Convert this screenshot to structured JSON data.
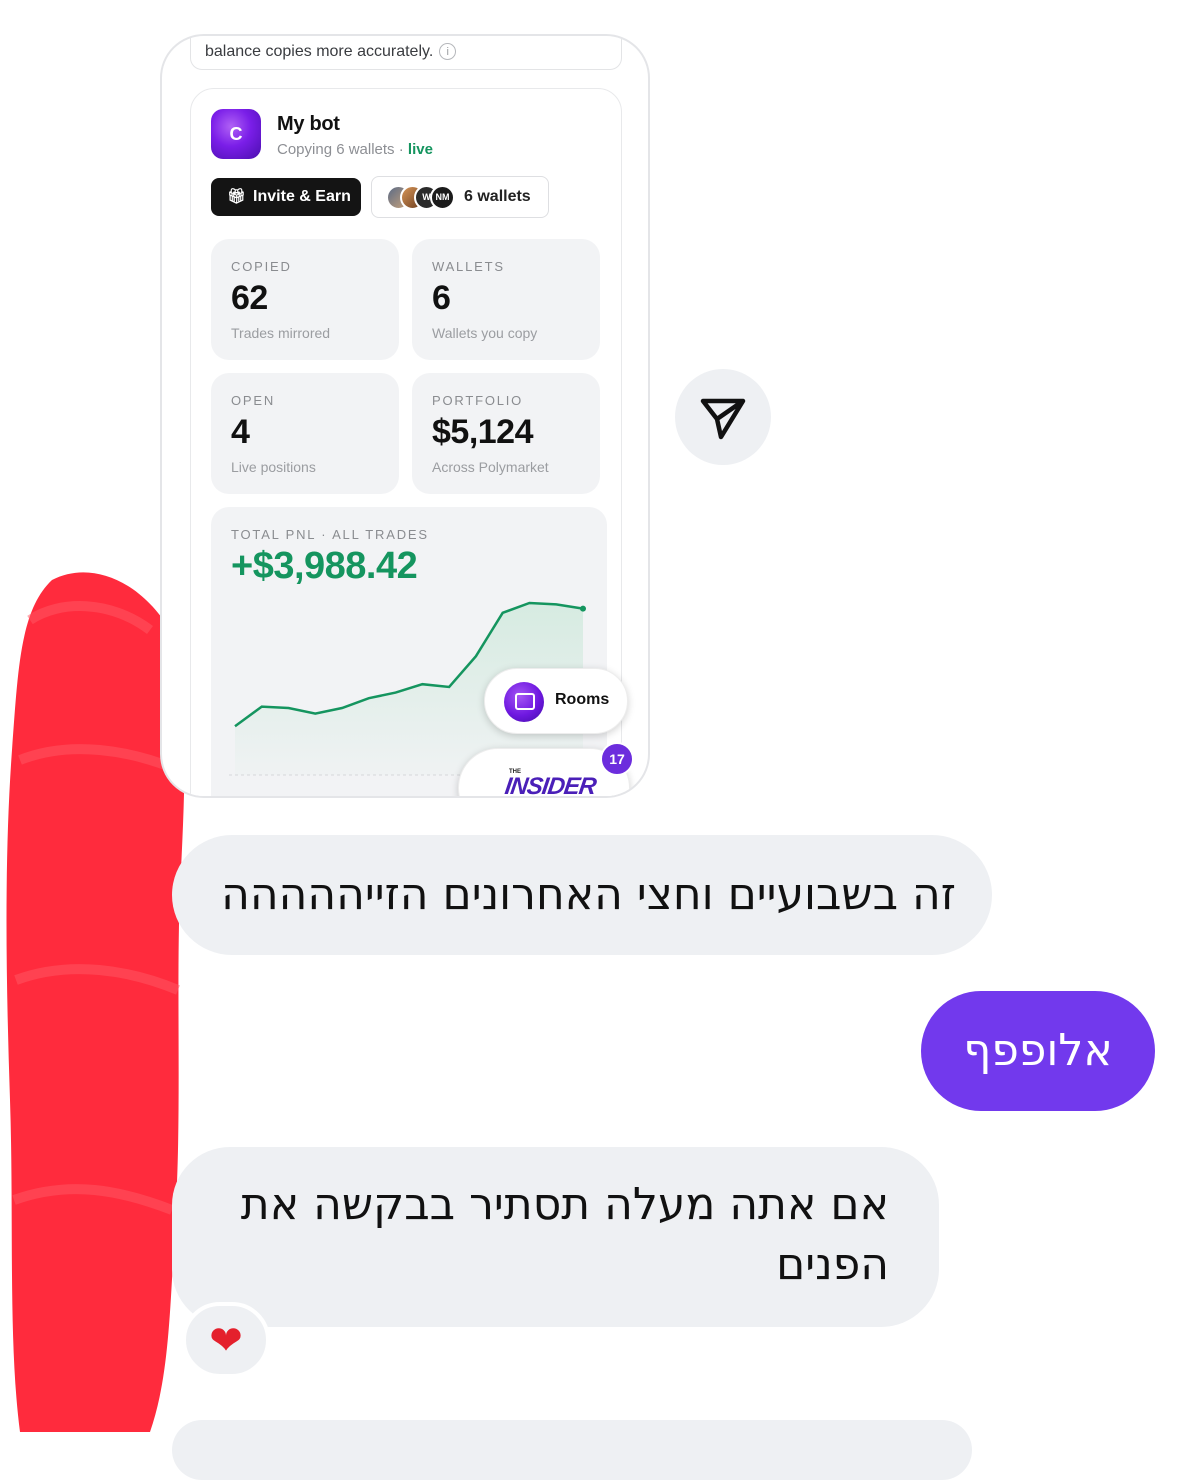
{
  "shot": {
    "info_text": "balance copies more accurately.",
    "info_icon": "info-icon",
    "bot": {
      "avatar_letter": "C",
      "name": "My bot",
      "sub_prefix": "Copying 6 wallets ·",
      "live_label": "live"
    },
    "invite_button": "Invite & Earn",
    "wallets_button": "6 wallets",
    "wallet_avatars": [
      "",
      "",
      "W",
      "NM"
    ],
    "stats": [
      {
        "label": "COPIED",
        "value": "62",
        "caption": "Trades mirrored"
      },
      {
        "label": "WALLETS",
        "value": "6",
        "caption": "Wallets you copy"
      },
      {
        "label": "OPEN",
        "value": "4",
        "caption": "Live positions"
      },
      {
        "label": "PORTFOLIO",
        "value": "$5,124",
        "caption": "Across Polymarket"
      }
    ],
    "pnl": {
      "label": "TOTAL PNL · ALL TRADES",
      "value": "+$3,988.42"
    },
    "rooms_label": "Rooms",
    "insider_small": "THE",
    "insider_logo": "INSIDER",
    "badge_count": "17"
  },
  "chart_data": {
    "type": "area",
    "title": "",
    "values": [
      0.12,
      0.26,
      0.25,
      0.21,
      0.25,
      0.32,
      0.36,
      0.42,
      0.4,
      0.62,
      0.93,
      1.0,
      0.99,
      0.96
    ],
    "line_color": "#15955f",
    "fill_color": "#d6ebe1"
  },
  "colors": {
    "accent": "#7239ed",
    "positive": "#15955f",
    "bubble_in": "#eef0f3",
    "redaction": "#ff2b3d"
  },
  "messages": {
    "m1": "זה בשבועיים וחצי האחרונים הזייההההה",
    "m2": "אלופפף",
    "m3": "אם אתה מעלה תסתיר בבקשה את הפנים",
    "reaction": "❤"
  },
  "share_icon": "send-icon"
}
